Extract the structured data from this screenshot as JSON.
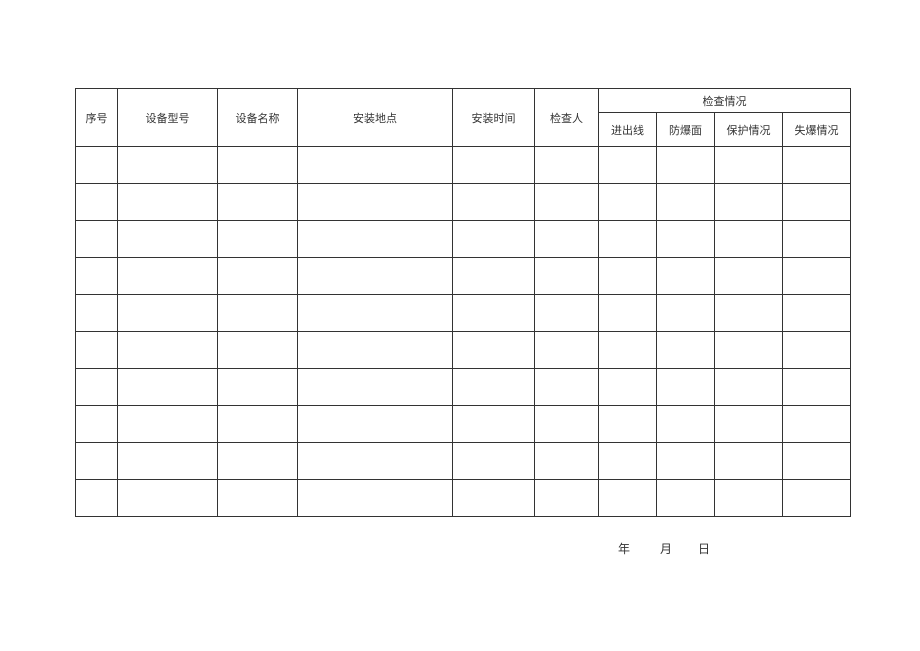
{
  "headers": {
    "seq": "序号",
    "model": "设备型号",
    "name": "设备名称",
    "location": "安装地点",
    "install_time": "安装时间",
    "inspector": "检查人",
    "inspection_group": "检查情况",
    "inspection_sub": {
      "inout_line": "进出线",
      "explosion_surface": "防爆面",
      "protection": "保护情况",
      "loss_explosion": "失爆情况"
    }
  },
  "rows": [
    {
      "seq": "",
      "model": "",
      "name": "",
      "location": "",
      "install_time": "",
      "inspector": "",
      "inout_line": "",
      "explosion_surface": "",
      "protection": "",
      "loss_explosion": ""
    },
    {
      "seq": "",
      "model": "",
      "name": "",
      "location": "",
      "install_time": "",
      "inspector": "",
      "inout_line": "",
      "explosion_surface": "",
      "protection": "",
      "loss_explosion": ""
    },
    {
      "seq": "",
      "model": "",
      "name": "",
      "location": "",
      "install_time": "",
      "inspector": "",
      "inout_line": "",
      "explosion_surface": "",
      "protection": "",
      "loss_explosion": ""
    },
    {
      "seq": "",
      "model": "",
      "name": "",
      "location": "",
      "install_time": "",
      "inspector": "",
      "inout_line": "",
      "explosion_surface": "",
      "protection": "",
      "loss_explosion": ""
    },
    {
      "seq": "",
      "model": "",
      "name": "",
      "location": "",
      "install_time": "",
      "inspector": "",
      "inout_line": "",
      "explosion_surface": "",
      "protection": "",
      "loss_explosion": ""
    },
    {
      "seq": "",
      "model": "",
      "name": "",
      "location": "",
      "install_time": "",
      "inspector": "",
      "inout_line": "",
      "explosion_surface": "",
      "protection": "",
      "loss_explosion": ""
    },
    {
      "seq": "",
      "model": "",
      "name": "",
      "location": "",
      "install_time": "",
      "inspector": "",
      "inout_line": "",
      "explosion_surface": "",
      "protection": "",
      "loss_explosion": ""
    },
    {
      "seq": "",
      "model": "",
      "name": "",
      "location": "",
      "install_time": "",
      "inspector": "",
      "inout_line": "",
      "explosion_surface": "",
      "protection": "",
      "loss_explosion": ""
    },
    {
      "seq": "",
      "model": "",
      "name": "",
      "location": "",
      "install_time": "",
      "inspector": "",
      "inout_line": "",
      "explosion_surface": "",
      "protection": "",
      "loss_explosion": ""
    },
    {
      "seq": "",
      "model": "",
      "name": "",
      "location": "",
      "install_time": "",
      "inspector": "",
      "inout_line": "",
      "explosion_surface": "",
      "protection": "",
      "loss_explosion": ""
    }
  ],
  "date_labels": {
    "year": "年",
    "month": "月",
    "day": "日"
  },
  "col_widths": {
    "seq": 42,
    "model": 100,
    "name": 80,
    "location": 155,
    "install_time": 82,
    "inspector": 64,
    "inout_line": 58,
    "explosion_surface": 58,
    "protection": 68,
    "loss_explosion": 68
  }
}
